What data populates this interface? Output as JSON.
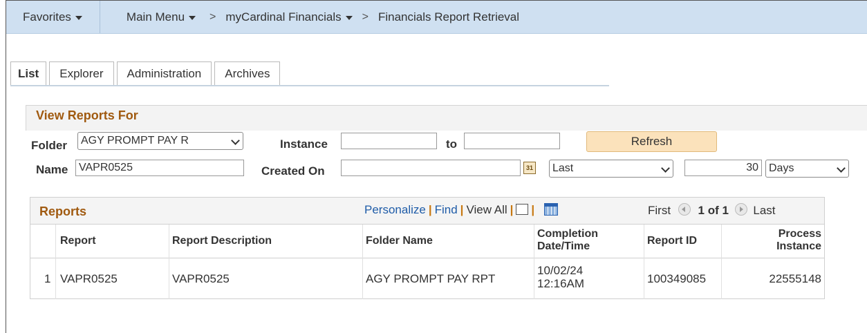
{
  "breadcrumb": {
    "favorites": "Favorites",
    "main_menu": "Main Menu",
    "sep": ">",
    "app": "myCardinal Financials",
    "page": "Financials Report Retrieval"
  },
  "tabs": [
    "List",
    "Explorer",
    "Administration",
    "Archives"
  ],
  "view_reports": {
    "title": "View Reports For",
    "folder_label": "Folder",
    "folder_value": "AGY PROMPT PAY R",
    "instance_label": "Instance",
    "instance_from": "",
    "to_label": "to",
    "instance_to": "",
    "refresh_label": "Refresh",
    "name_label": "Name",
    "name_value": "VAPR0525",
    "created_on_label": "Created On",
    "created_on_value": "",
    "calendar_glyph": "31",
    "period_value": "Last",
    "count_value": "30",
    "unit_value": "Days"
  },
  "reports": {
    "title": "Reports",
    "personalize": "Personalize",
    "find": "Find",
    "view_all": "View All",
    "first": "First",
    "page_info": "1 of 1",
    "last": "Last",
    "pipe": "|",
    "columns": {
      "report": "Report",
      "description": "Report Description",
      "folder": "Folder Name",
      "completion_1": "Completion",
      "completion_2": "Date/Time",
      "report_id": "Report ID",
      "process_1": "Process",
      "process_2": "Instance"
    },
    "rows": [
      {
        "num": "1",
        "report": "VAPR0525",
        "description": "VAPR0525",
        "folder": "AGY PROMPT PAY RPT",
        "date": "10/02/24",
        "time": "12:16AM",
        "report_id": "100349085",
        "process_instance": "22555148"
      }
    ]
  },
  "colors": {
    "accent_title": "#a05a10",
    "link": "#1f5ca8",
    "nav_bg": "#cfe0f1",
    "refresh_bg": "#fbe2bb"
  }
}
